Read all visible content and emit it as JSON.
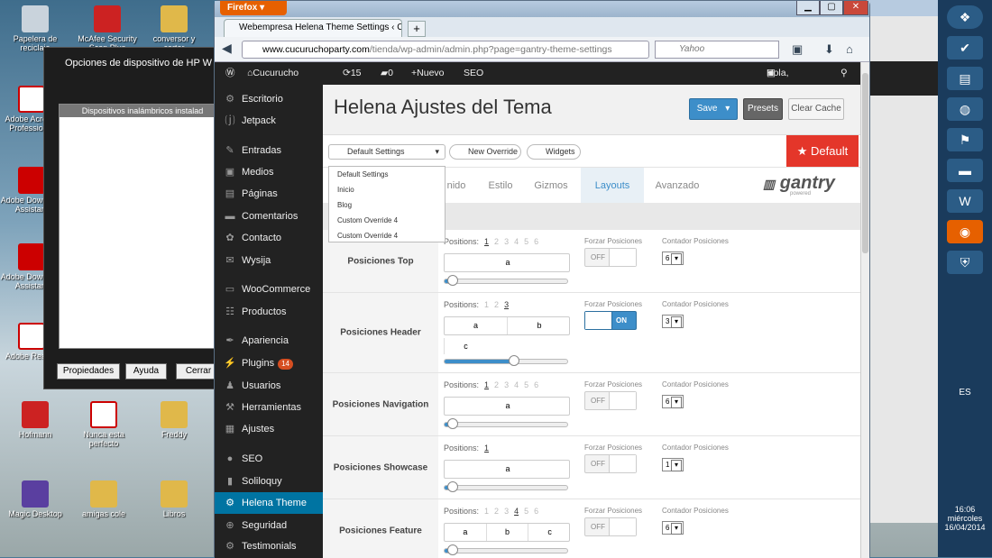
{
  "desktop": {
    "icons": [
      {
        "label": "Papelera de reciclaje"
      },
      {
        "label": "McAfee Security Scan Plus"
      },
      {
        "label": "conversor y cortar"
      },
      {
        "label": "Adobe Acrobat Professional"
      },
      {
        "label": "Adobe Download Assistant"
      },
      {
        "label": "Adobe Download Assistant"
      },
      {
        "label": "Adobe Reader"
      },
      {
        "label": "Hofmann"
      },
      {
        "label": "Nunca esta perfecto"
      },
      {
        "label": "Freddy"
      },
      {
        "label": "Magic Desktop"
      },
      {
        "label": "amigas cole"
      },
      {
        "label": "Libros"
      }
    ]
  },
  "hp_dialog": {
    "title": "Opciones de dispositivo de HP W",
    "subtitle": "Dispositivos inalámbricos instalad",
    "buttons": [
      "Propiedades",
      "Ayuda",
      "Cerrar"
    ]
  },
  "firefox": {
    "menu_button": "Firefox",
    "tab_title": "Webempresa Helena Theme Settings ‹ C...",
    "url_domain": "www.cucuruchoparty.com",
    "url_path": "/tienda/wp-admin/admin.php?page=gantry-theme-settings",
    "search_placeholder": "Yahoo"
  },
  "adminbar": {
    "site": "Cucurucho Party",
    "updates": "15",
    "comments": "0",
    "new": "Nuevo",
    "seo": "SEO",
    "greeting": "Hola, admin"
  },
  "sidebar": {
    "items": [
      {
        "label": "Escritorio",
        "icon": "dashboard-icon",
        "glyph": "⚙"
      },
      {
        "label": "Jetpack",
        "icon": "jetpack-icon",
        "glyph": "⒥"
      },
      {
        "label": "Entradas",
        "icon": "pin-icon",
        "glyph": "✎"
      },
      {
        "label": "Medios",
        "icon": "media-icon",
        "glyph": "▣"
      },
      {
        "label": "Páginas",
        "icon": "pages-icon",
        "glyph": "▤"
      },
      {
        "label": "Comentarios",
        "icon": "comment-icon",
        "glyph": "▬"
      },
      {
        "label": "Contacto",
        "icon": "contact-icon",
        "glyph": "✿"
      },
      {
        "label": "Wysija",
        "icon": "mail-icon",
        "glyph": "✉"
      },
      {
        "label": "WooCommerce",
        "icon": "woo-icon",
        "glyph": "▭"
      },
      {
        "label": "Productos",
        "icon": "products-icon",
        "glyph": "☷"
      },
      {
        "label": "Apariencia",
        "icon": "brush-icon",
        "glyph": "✒"
      },
      {
        "label": "Plugins",
        "icon": "plugin-icon",
        "glyph": "⚡",
        "badge": "14"
      },
      {
        "label": "Usuarios",
        "icon": "users-icon",
        "glyph": "♟"
      },
      {
        "label": "Herramientas",
        "icon": "tools-icon",
        "glyph": "⚒"
      },
      {
        "label": "Ajustes",
        "icon": "settings-icon",
        "glyph": "▦"
      },
      {
        "label": "SEO",
        "icon": "seo-icon",
        "glyph": "●"
      },
      {
        "label": "Soliloquy",
        "icon": "soliloquy-icon",
        "glyph": "▮"
      },
      {
        "label": "Helena Theme",
        "icon": "theme-icon",
        "glyph": "⚙"
      },
      {
        "label": "Seguridad",
        "icon": "security-icon",
        "glyph": "⊕"
      },
      {
        "label": "Testimonials",
        "icon": "testimonials-icon",
        "glyph": "⚙"
      }
    ]
  },
  "page": {
    "title": "Helena Ajustes del Tema",
    "save": "Save",
    "presets": "Presets",
    "clear_cache": "Clear Cache"
  },
  "toolbar": {
    "settings_select": "Default Settings",
    "new_override": "New Override",
    "widgets": "Widgets",
    "default_badge": "★ Default"
  },
  "dropdown": {
    "options": [
      "Default Settings",
      "Inicio",
      "Blog",
      "Custom Override 4",
      "Custom Override 4"
    ]
  },
  "gantry_tabs": [
    "nido",
    "Estilo",
    "Gizmos",
    "Layouts",
    "Avanzado"
  ],
  "gantry_logo": {
    "name": "gantry",
    "sub": "powered"
  },
  "labels": {
    "positions": "Positions:",
    "forzar": "Forzar Posiciones",
    "contador": "Contador Posiciones",
    "off": "OFF",
    "on": "ON"
  },
  "rows": [
    {
      "label": "Posiciones Top",
      "selected": 1,
      "boxes": [
        "a"
      ],
      "toggle": "OFF",
      "count": "6",
      "slider": 0.05
    },
    {
      "label": "Posiciones Header",
      "selected": 3,
      "max": 3,
      "boxes": [
        "a",
        "b"
      ],
      "extra": "c",
      "toggle": "ON",
      "count": "3",
      "slider": 0.55
    },
    {
      "label": "Posiciones Navigation",
      "selected": 1,
      "boxes": [
        "a"
      ],
      "toggle": "OFF",
      "count": "6",
      "slider": 0.05
    },
    {
      "label": "Posiciones Showcase",
      "selected": 1,
      "max": 1,
      "boxes": [
        "a"
      ],
      "toggle": "OFF",
      "count": "1",
      "slider": 0.05
    },
    {
      "label": "Posiciones Feature",
      "selected": 4,
      "boxes": [
        "a",
        "b",
        "c"
      ],
      "toggle": "OFF",
      "count": "6",
      "slider": 0.05
    }
  ],
  "taskbar": {
    "lang": "ES",
    "time": "16:06",
    "day": "miércoles",
    "date": "16/04/2014"
  }
}
